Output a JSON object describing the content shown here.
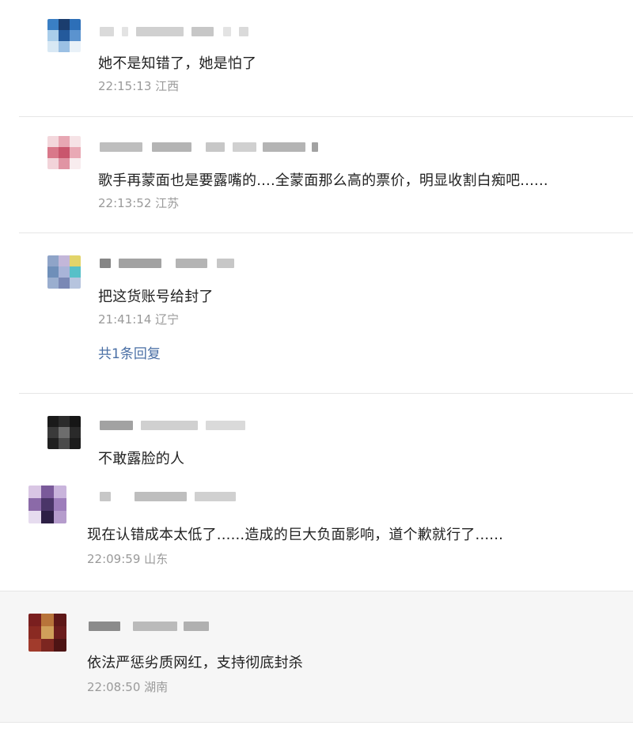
{
  "comments": [
    {
      "text": "她不是知错了，她是怕了",
      "time": "22:15:13",
      "location": "江西"
    },
    {
      "text": "歌手再蒙面也是要露嘴的....全蒙面那么高的票价，明显收割白痴吧......",
      "time": "22:13:52",
      "location": "江苏"
    },
    {
      "text": "把这货账号给封了",
      "time": "21:41:14",
      "location": "辽宁",
      "replies_label": "共1条回复"
    },
    {
      "text": "不敢露脸的人"
    },
    {
      "text": "现在认错成本太低了......造成的巨大负面影响，道个歉就行了......",
      "time": "22:09:59",
      "location": "山东"
    },
    {
      "text": "依法严惩劣质网红，支持彻底封杀",
      "time": "22:08:50",
      "location": "湖南"
    }
  ]
}
